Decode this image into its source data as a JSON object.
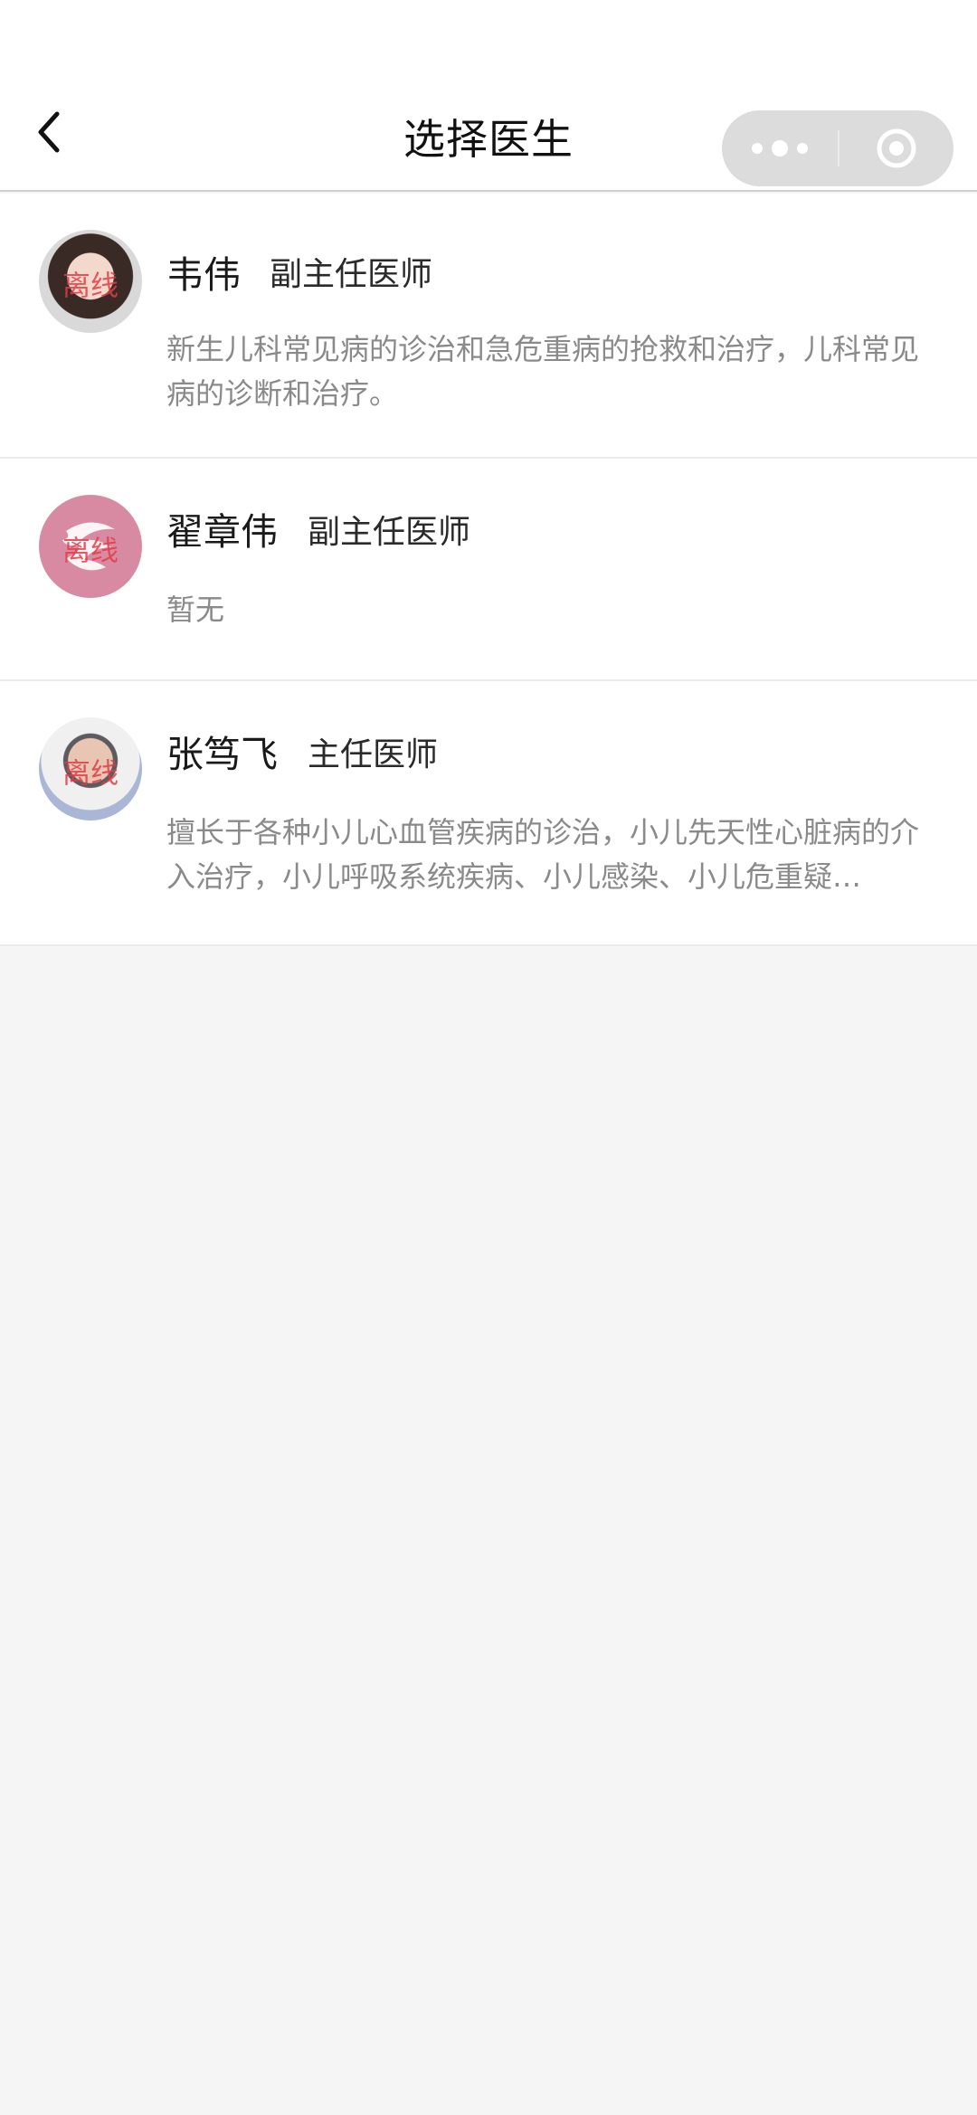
{
  "header": {
    "title": "选择医生",
    "back_icon": "chevron-left-icon",
    "more_icon": "more-dots-icon",
    "close_icon": "target-circle-icon"
  },
  "offline_label": "离线",
  "doctors": [
    {
      "name": "韦伟",
      "grade": "副主任医师",
      "description": "新生儿科常见病的诊治和急危重病的抢救和治疗，儿科常见病的诊断和治疗。",
      "status": "离线"
    },
    {
      "name": "翟章伟",
      "grade": "副主任医师",
      "description": "暂无",
      "status": "离线"
    },
    {
      "name": "张笃飞",
      "grade": "主任医师",
      "description": "擅长于各种小儿心血管疾病的诊治，小儿先天性心脏病的介入治疗，小儿呼吸系统疾病、小儿感染、小儿危重疑…",
      "status": "离线"
    }
  ],
  "colors": {
    "background": "#f5f5f5",
    "card": "#ffffff",
    "offline_text": "#e13c46",
    "capsule": "#dcdcdc"
  }
}
